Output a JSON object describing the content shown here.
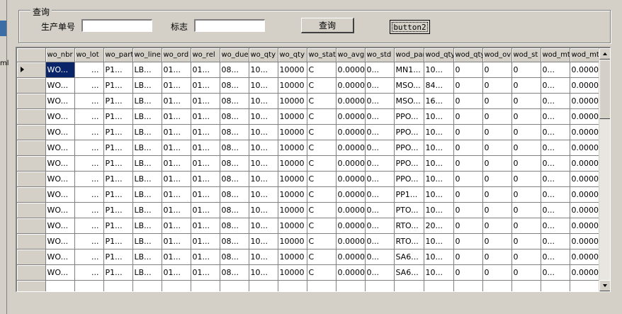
{
  "query": {
    "group_title": "查询",
    "order_label": "生产单号",
    "order_value": "",
    "flag_label": "标志",
    "flag_value": "",
    "query_button": "查询",
    "button2": "button2"
  },
  "grid": {
    "columns": [
      "wo_nbr",
      "wo_lot",
      "wo_part",
      "wo_line",
      "wo_ord",
      "wo_rel",
      "wo_due",
      "wo_qty",
      "wo_qty",
      "wo_stat",
      "wo_avg",
      "wo_std",
      "wod_part",
      "wod_qty",
      "wod_qty",
      "wod_ov",
      "wod_st",
      "wod_mt",
      "wod_mt"
    ],
    "selected_row": 0,
    "rows": [
      [
        "WO...",
        "...",
        "P1...",
        "LB...",
        "01...",
        "01...",
        "08...",
        "10...",
        "10000",
        "C",
        "0.0000",
        "0...",
        "MN1...",
        "10...",
        "0",
        "0",
        "0",
        "0...",
        "0.0000"
      ],
      [
        "WO...",
        "...",
        "P1...",
        "LB...",
        "01...",
        "01...",
        "08...",
        "10...",
        "10000",
        "C",
        "0.0000",
        "0...",
        "MSO...",
        "84...",
        "0",
        "0",
        "0",
        "0...",
        "0.0000"
      ],
      [
        "WO...",
        "...",
        "P1...",
        "LB...",
        "01...",
        "01...",
        "08...",
        "10...",
        "10000",
        "C",
        "0.0000",
        "0...",
        "MSO...",
        "16...",
        "0",
        "0",
        "0",
        "0...",
        "0.0000"
      ],
      [
        "WO...",
        "...",
        "P1...",
        "LB...",
        "01...",
        "01...",
        "08...",
        "10...",
        "10000",
        "C",
        "0.0000",
        "0...",
        "PPO...",
        "10...",
        "0",
        "0",
        "0",
        "0...",
        "0.0000"
      ],
      [
        "WO...",
        "...",
        "P1...",
        "LB...",
        "01...",
        "01...",
        "08...",
        "10...",
        "10000",
        "C",
        "0.0000",
        "0...",
        "PPO...",
        "10...",
        "0",
        "0",
        "0",
        "0...",
        "0.0000"
      ],
      [
        "WO...",
        "...",
        "P1...",
        "LB...",
        "01...",
        "01...",
        "08...",
        "10...",
        "10000",
        "C",
        "0.0000",
        "0...",
        "PPO...",
        "10...",
        "0",
        "0",
        "0",
        "0...",
        "0.0000"
      ],
      [
        "WO...",
        "...",
        "P1...",
        "LB...",
        "01...",
        "01...",
        "08...",
        "10...",
        "10000",
        "C",
        "0.0000",
        "0...",
        "PPO...",
        "10...",
        "0",
        "0",
        "0",
        "0...",
        "0.0000"
      ],
      [
        "WO...",
        "...",
        "P1...",
        "LB...",
        "01...",
        "01...",
        "08...",
        "10...",
        "10000",
        "C",
        "0.0000",
        "0...",
        "PPO...",
        "10...",
        "0",
        "0",
        "0",
        "0...",
        "0.0000"
      ],
      [
        "WO...",
        "...",
        "P1...",
        "LB...",
        "01...",
        "01...",
        "08...",
        "10...",
        "10000",
        "C",
        "0.0000",
        "0...",
        "PP1...",
        "10...",
        "0",
        "0",
        "0",
        "0...",
        "0.0000"
      ],
      [
        "WO...",
        "...",
        "P1...",
        "LB...",
        "01...",
        "01...",
        "08...",
        "10...",
        "10000",
        "C",
        "0.0000",
        "0...",
        "PTO...",
        "10...",
        "0",
        "0",
        "0",
        "0...",
        "0.0000"
      ],
      [
        "WO...",
        "...",
        "P1...",
        "LB...",
        "01...",
        "01...",
        "08...",
        "10...",
        "10000",
        "C",
        "0.0000",
        "0...",
        "RTO...",
        "20...",
        "0",
        "0",
        "0",
        "0...",
        "0.0000"
      ],
      [
        "WO...",
        "...",
        "P1...",
        "LB...",
        "01...",
        "01...",
        "08...",
        "10...",
        "10000",
        "C",
        "0.0000",
        "0...",
        "RTO...",
        "10...",
        "0",
        "0",
        "0",
        "0...",
        "0.0000"
      ],
      [
        "WO...",
        "...",
        "P1...",
        "LB...",
        "01...",
        "01...",
        "08...",
        "10...",
        "10000",
        "C",
        "0.0000",
        "0...",
        "SA6...",
        "10...",
        "0",
        "0",
        "0",
        "0...",
        "0.0000"
      ],
      [
        "WO...",
        "...",
        "P1...",
        "LB...",
        "01...",
        "01...",
        "08...",
        "10...",
        "10000",
        "C",
        "0.0000",
        "0...",
        "SA6...",
        "10...",
        "0",
        "0",
        "0",
        "0...",
        "0.0000"
      ],
      [
        "",
        "",
        "",
        "",
        "",
        "",
        "",
        "",
        "",
        "",
        "",
        "",
        "",
        "",
        "",
        "",
        "",
        "",
        ""
      ]
    ]
  },
  "colors": {
    "window_bg": "#d4d0c8",
    "selection": "#0a246a",
    "grid_line": "#808080"
  }
}
